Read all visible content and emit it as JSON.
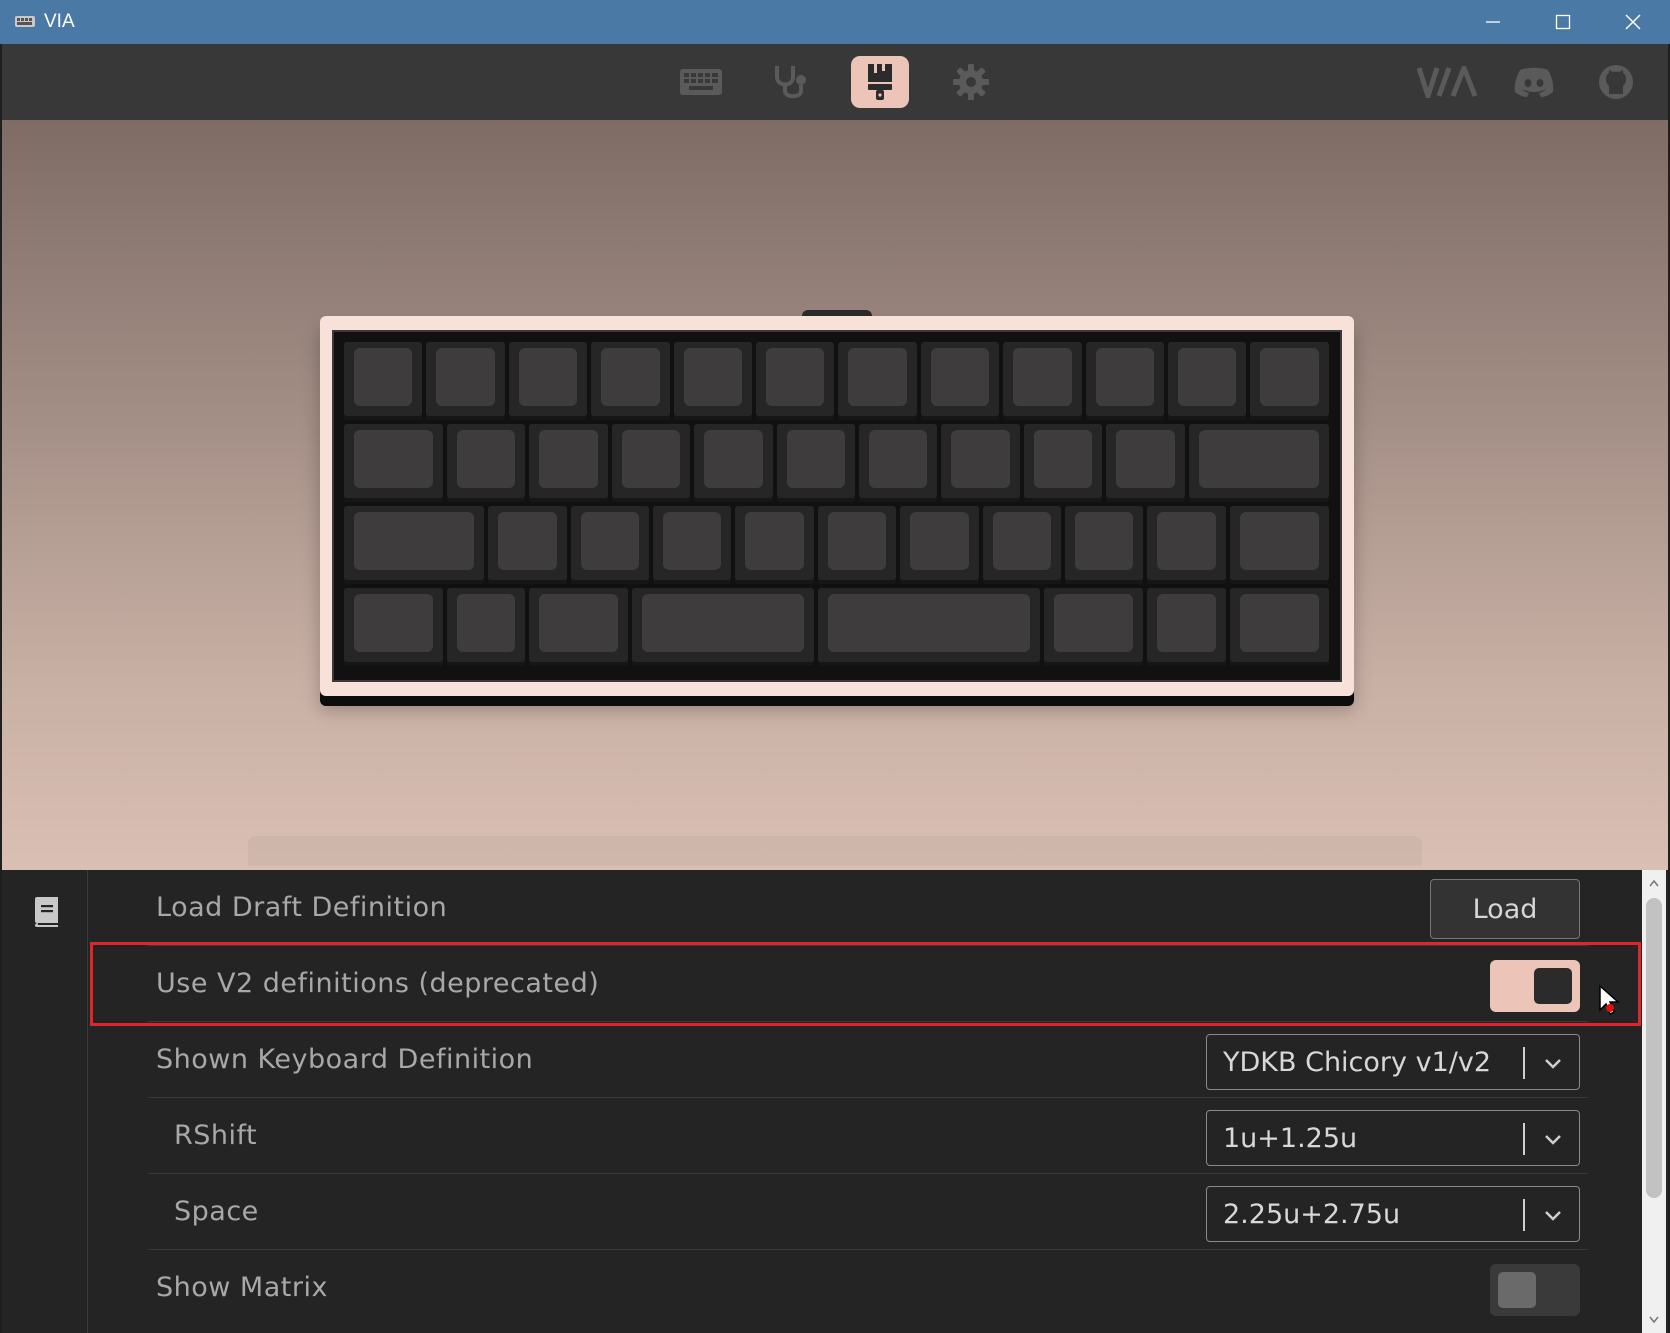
{
  "window": {
    "title": "VIA"
  },
  "toolbar": {
    "tabs": [
      {
        "name": "configure",
        "icon": "keyboard-icon",
        "active": false
      },
      {
        "name": "test",
        "icon": "stethoscope-icon",
        "active": false
      },
      {
        "name": "design",
        "icon": "paintbrush-icon",
        "active": true
      },
      {
        "name": "settings",
        "icon": "gear-icon",
        "active": false
      }
    ],
    "links": [
      {
        "label": "VIA",
        "icon": "via-logo-icon"
      },
      {
        "icon": "discord-icon"
      },
      {
        "icon": "github-icon"
      }
    ]
  },
  "settings": {
    "load_draft": {
      "label": "Load Draft Definition",
      "button": "Load"
    },
    "use_v2": {
      "label": "Use V2 definitions (deprecated)",
      "enabled": true
    },
    "shown_definition": {
      "label": "Shown Keyboard Definition",
      "value": "YDKB Chicory v1/v2"
    },
    "rshift": {
      "label": "RShift",
      "value": "1u+1.25u"
    },
    "space": {
      "label": "Space",
      "value": "2.25u+2.75u"
    },
    "show_matrix": {
      "label": "Show Matrix",
      "enabled": false
    }
  },
  "colors": {
    "accent": "#ecc4b8",
    "titlebar": "#4b79a6",
    "highlight": "#e0262b"
  }
}
